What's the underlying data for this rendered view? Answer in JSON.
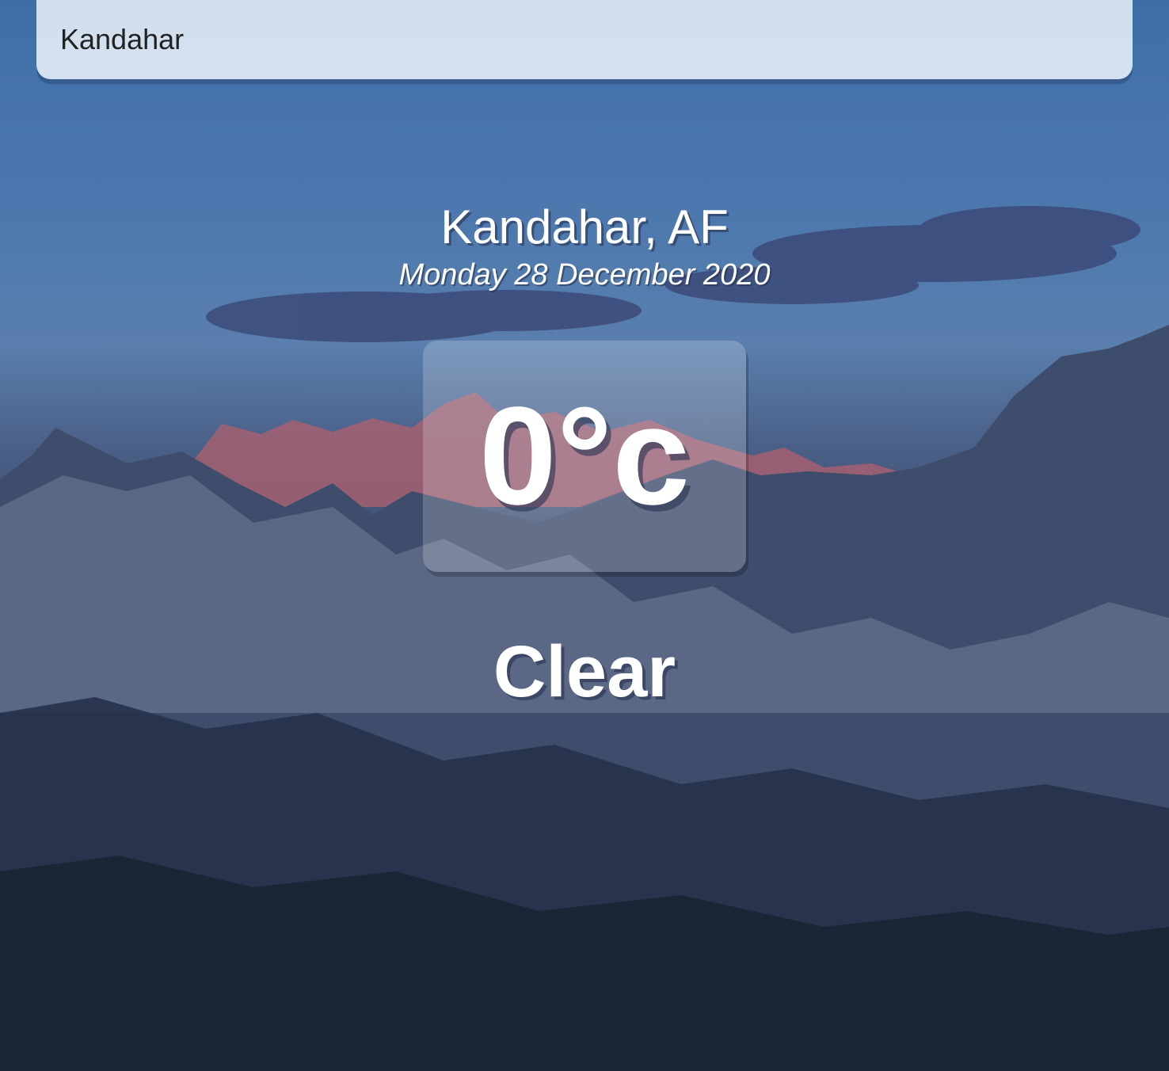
{
  "search": {
    "value": "Kandahar"
  },
  "location": {
    "city_country": "Kandahar, AF",
    "date": "Monday 28 December 2020"
  },
  "weather": {
    "temperature": "0°c",
    "condition": "Clear"
  },
  "background": {
    "scene": "snowy-mountains-at-dusk"
  },
  "colors": {
    "sky": "#4a77ae",
    "mountain_dark": "#2c3a56",
    "peak_glow": "#c86a72",
    "text": "#ffffff"
  }
}
